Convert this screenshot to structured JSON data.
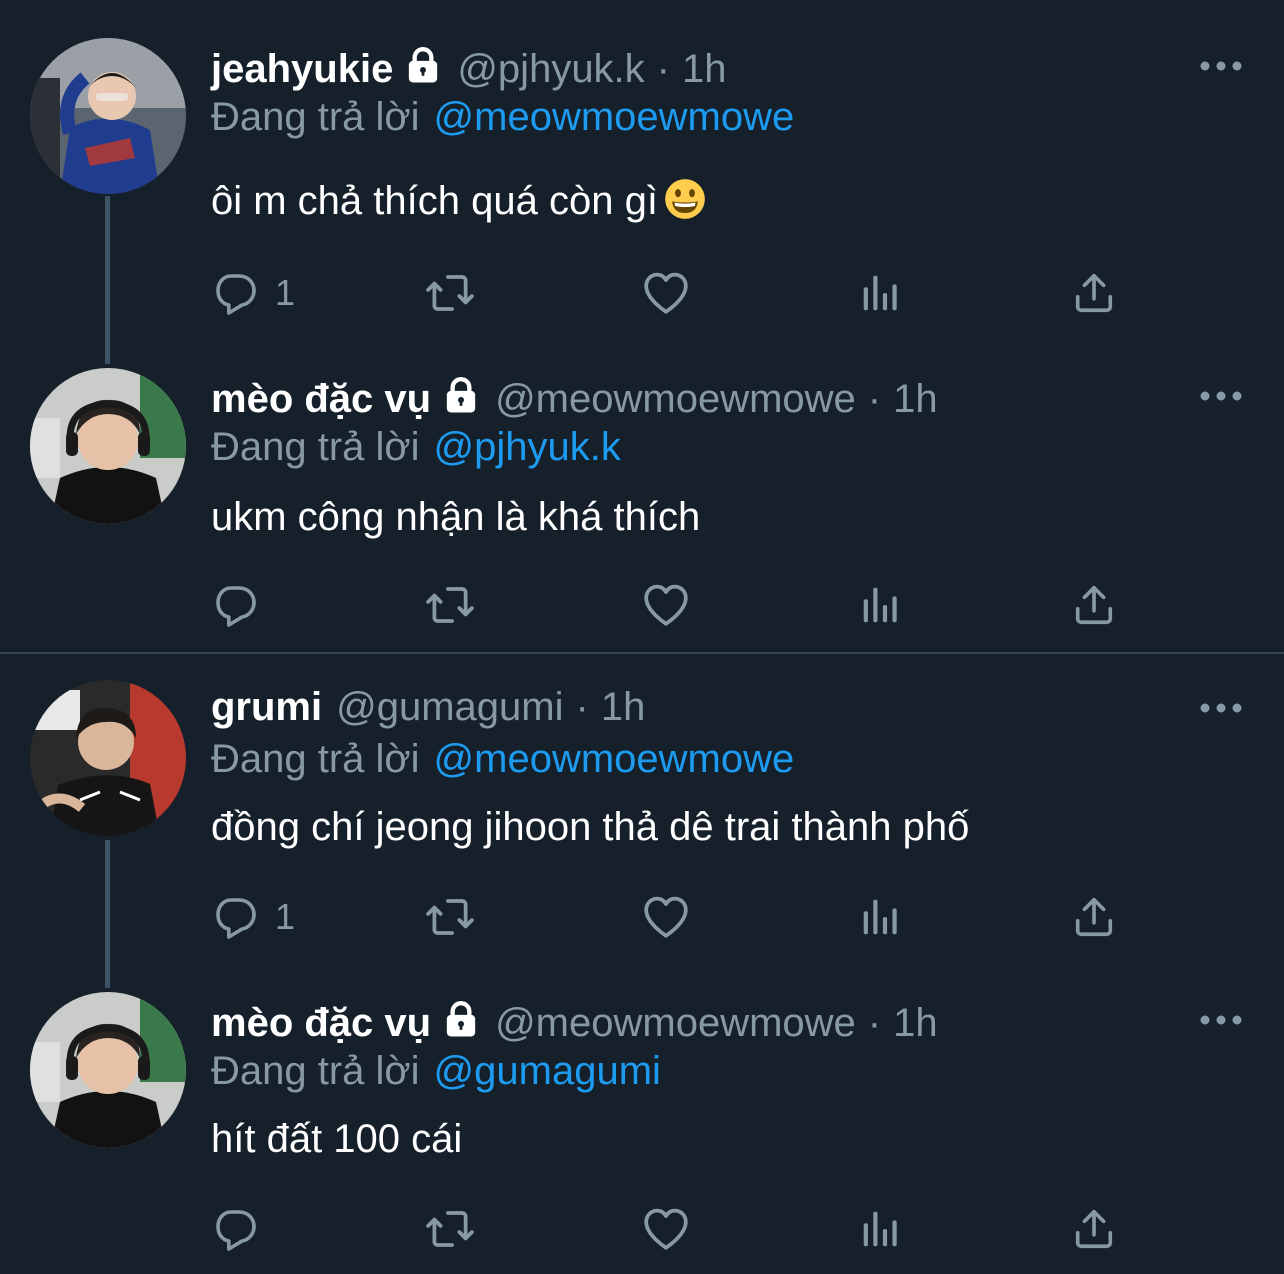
{
  "colors": {
    "background": "#15202b",
    "muted": "#8899a6",
    "link": "#1d9bf0",
    "divider": "#38444d",
    "thread_line": "#3d5466"
  },
  "labels": {
    "replying_to": "Đang trả lời",
    "separator": "·"
  },
  "tweets": [
    {
      "display_name": "jeahyukie",
      "protected": true,
      "handle": "@pjhyuk.k",
      "time": "1h",
      "reply_to": "@meowmoewmowe",
      "text": "ôi m chả thích quá còn gì",
      "emoji": "grinning-face",
      "reply_count": "1",
      "avatar_icon": "user-avatar-photo"
    },
    {
      "display_name": "mèo đặc vụ",
      "protected": true,
      "handle": "@meowmoewmowe",
      "time": "1h",
      "reply_to": "@pjhyuk.k",
      "text": "ukm công nhận là khá thích",
      "reply_count": "",
      "avatar_icon": "user-avatar-photo"
    },
    {
      "display_name": "grumi",
      "protected": false,
      "handle": "@gumagumi",
      "time": "1h",
      "reply_to": "@meowmoewmowe",
      "text": "đồng chí jeong jihoon thả dê trai thành phố",
      "reply_count": "1",
      "avatar_icon": "user-avatar-photo"
    },
    {
      "display_name": "mèo đặc vụ",
      "protected": true,
      "handle": "@meowmoewmowe",
      "time": "1h",
      "reply_to": "@gumagumi",
      "text": "hít đất 100 cái",
      "reply_count": "",
      "avatar_icon": "user-avatar-photo"
    }
  ],
  "action_icons": [
    "reply-icon",
    "retweet-icon",
    "like-icon",
    "analytics-icon",
    "share-icon"
  ]
}
